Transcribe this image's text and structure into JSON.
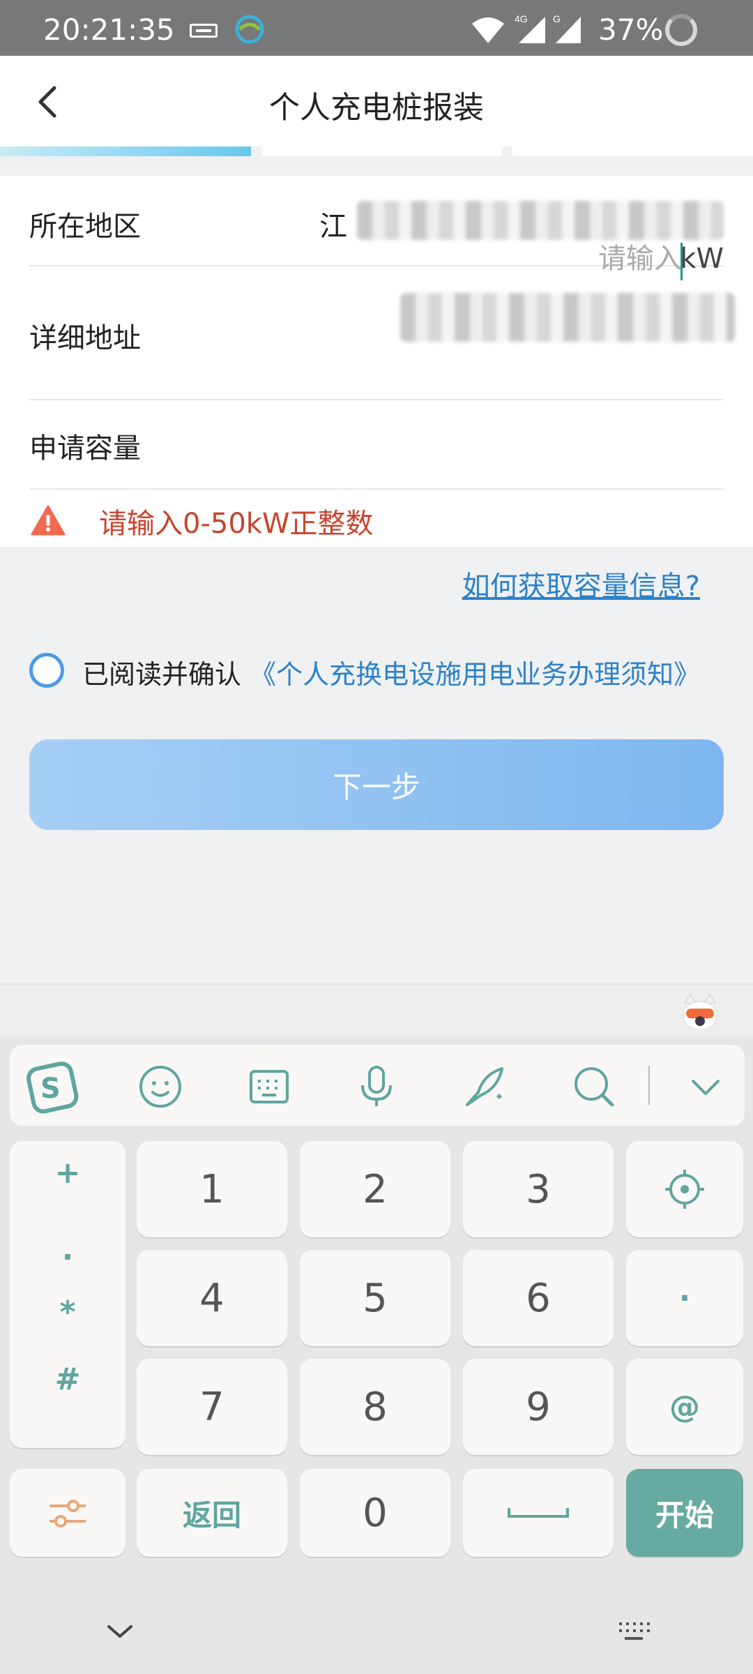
{
  "status_bar": {
    "time": "20:21:35",
    "battery": "37%",
    "net_label_1": "4G",
    "net_label_2": "G"
  },
  "header": {
    "title": "个人充电桩报装"
  },
  "progress": {
    "current_step": 1,
    "total_steps": 3
  },
  "form": {
    "region": {
      "label": "所在地区",
      "value_visible": "江"
    },
    "address": {
      "label": "详细地址"
    },
    "capacity": {
      "label": "申请容量",
      "placeholder": "请输入",
      "value": "",
      "unit": "kW"
    },
    "warning": "请输入0-50kW正整数"
  },
  "help_link": "如何获取容量信息?",
  "agreement": {
    "prefix": "已阅读并确认",
    "link": "《个人充换电设施用电业务办理须知》",
    "checked": false
  },
  "next_button": "下一步",
  "keyboard": {
    "symbols": [
      "+",
      ".",
      "*",
      "#"
    ],
    "digits": [
      "1",
      "2",
      "3",
      "4",
      "5",
      "6",
      "7",
      "8",
      "9"
    ],
    "zero": "0",
    "back": "返回",
    "start": "开始",
    "dot": "·",
    "at": "@"
  },
  "colors": {
    "accent_teal": "#66aaa2",
    "link_blue": "#2c82c9",
    "warning_red": "#c8442c",
    "button_blue": "#7db6ef"
  }
}
